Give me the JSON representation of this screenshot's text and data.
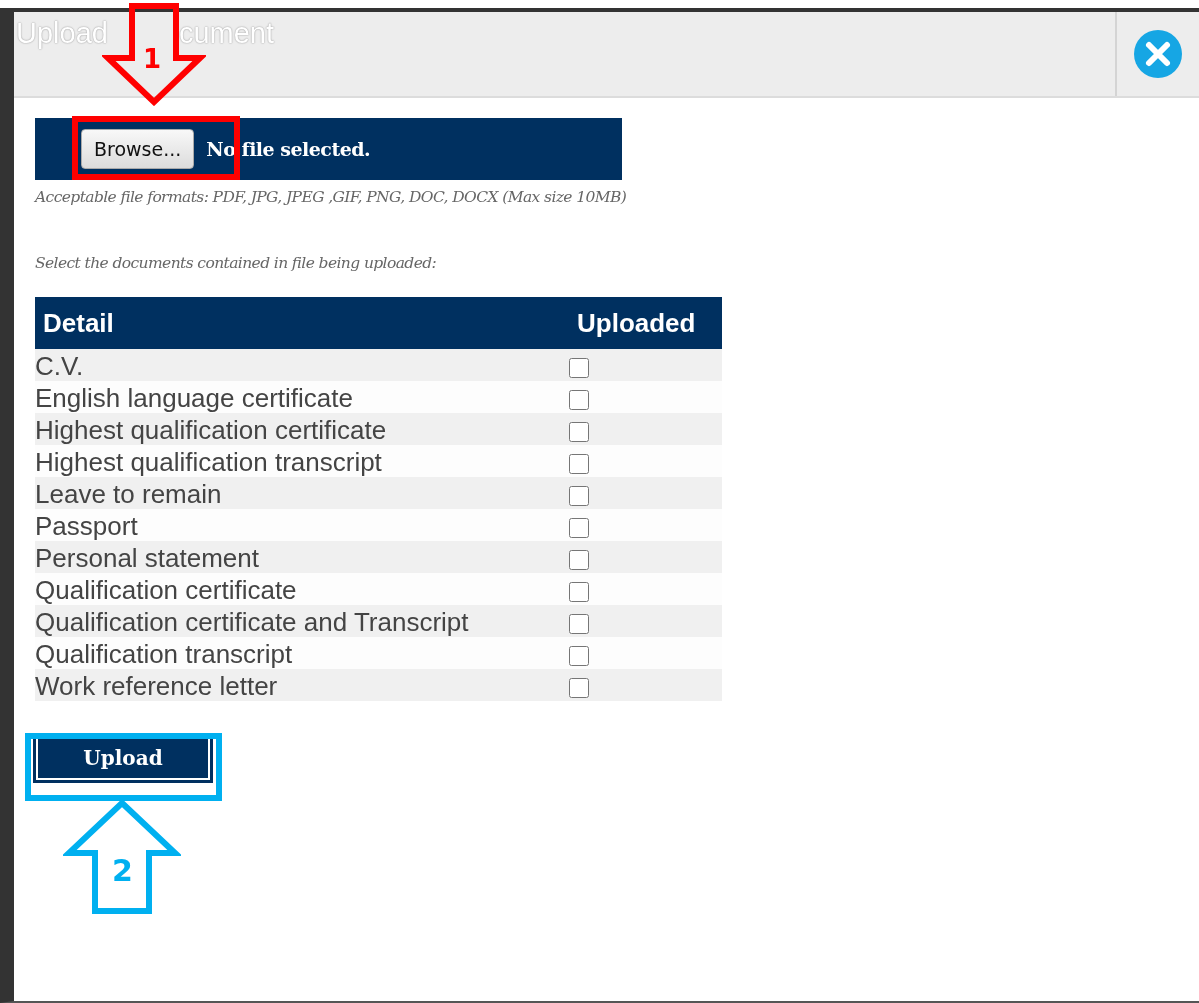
{
  "dialog": {
    "title_parts": [
      "Upload",
      "cument"
    ]
  },
  "file_picker": {
    "button": "Browse...",
    "status": "No file selected."
  },
  "formats_note": "Acceptable file formats: PDF, JPG, JPEG ,GIF, PNG, DOC, DOCX (Max size 10MB)",
  "instruction": "Select the documents contained in file being uploaded:",
  "table": {
    "columns": [
      "Detail",
      "Uploaded"
    ],
    "rows": [
      {
        "detail": "C.V.",
        "checked": false
      },
      {
        "detail": "English language certificate",
        "checked": false
      },
      {
        "detail": "Highest qualification certificate",
        "checked": false
      },
      {
        "detail": "Highest qualification transcript",
        "checked": false
      },
      {
        "detail": "Leave to remain",
        "checked": false
      },
      {
        "detail": "Passport",
        "checked": false
      },
      {
        "detail": "Personal statement",
        "checked": false
      },
      {
        "detail": "Qualification certificate",
        "checked": false
      },
      {
        "detail": "Qualification certificate and Transcript",
        "checked": false
      },
      {
        "detail": "Qualification transcript",
        "checked": false
      },
      {
        "detail": "Work reference letter",
        "checked": false
      }
    ]
  },
  "upload_button": "Upload",
  "annotations": [
    {
      "kind": "down",
      "number": "1",
      "color": "#ff0000"
    },
    {
      "kind": "up",
      "number": "2",
      "color": "#00b0f0"
    }
  ]
}
